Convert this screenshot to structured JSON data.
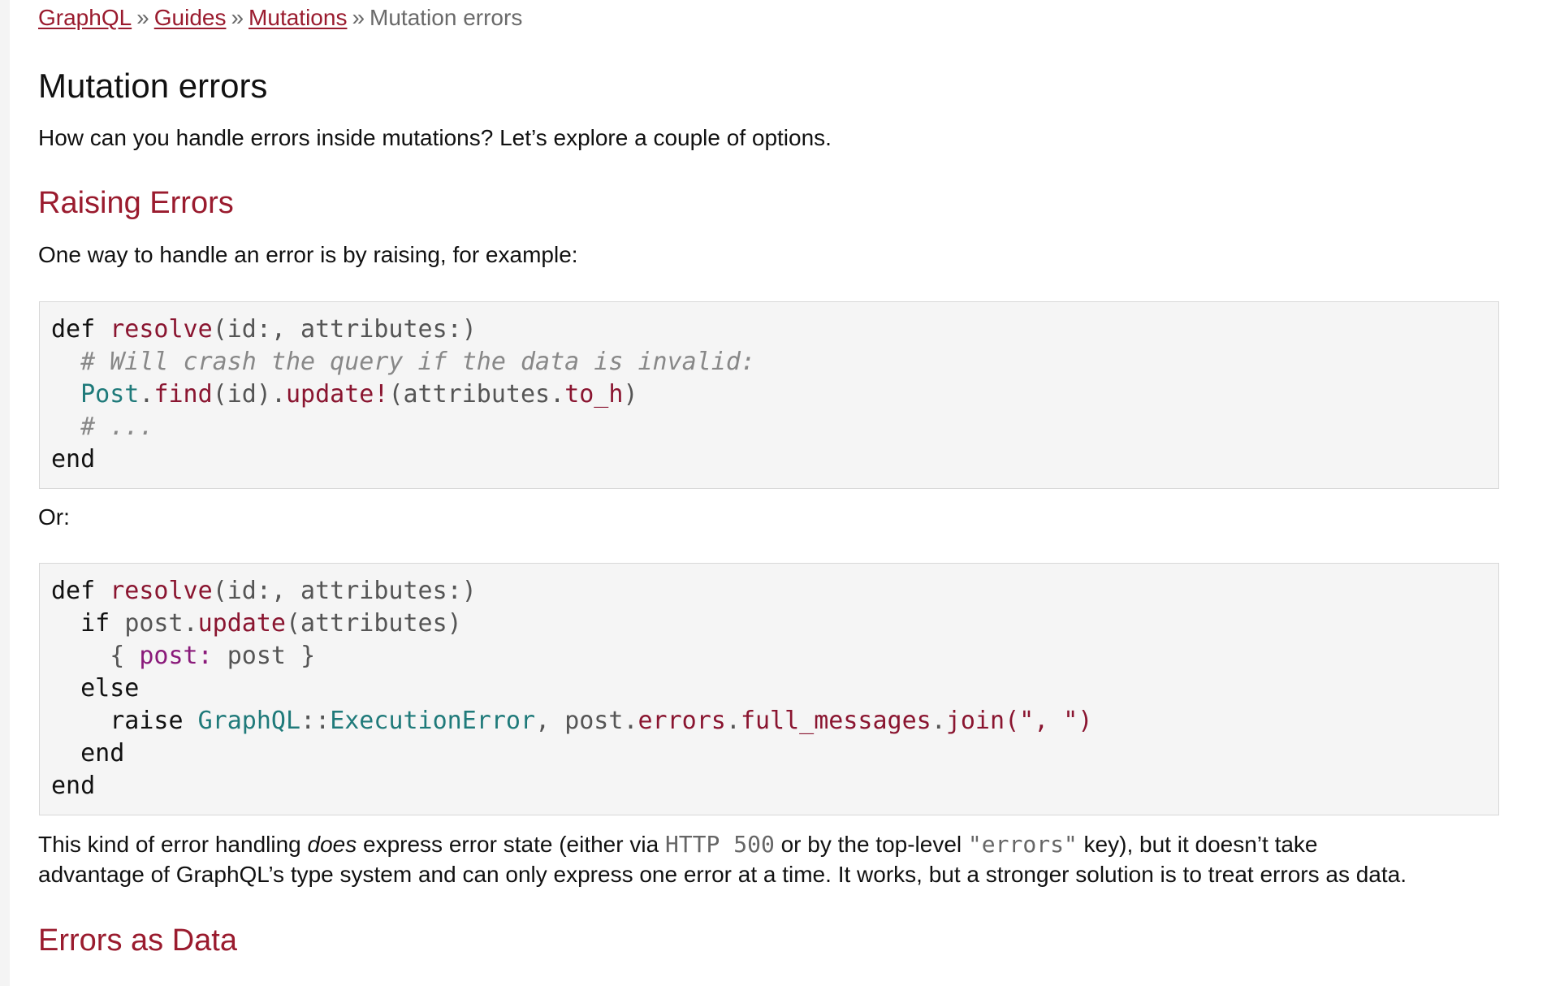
{
  "breadcrumb": {
    "items": [
      "GraphQL",
      "Guides",
      "Mutations"
    ],
    "separator": "»",
    "current": "Mutation errors"
  },
  "page": {
    "title": "Mutation errors",
    "intro": "How can you handle errors inside mutations? Let’s explore a couple of options."
  },
  "section1": {
    "heading": "Raising Errors",
    "text": "One way to handle an error is by raising, for example:",
    "or": "Or:"
  },
  "code1": {
    "def": "def",
    "resolve": "resolve",
    "args": "(id:, attributes:)",
    "comment1": "# Will crash the query if the data is invalid:",
    "post": "Post",
    "find": "find",
    "id_arg": "(id)",
    "update_bang": "update!",
    "attrs_open": "(attributes",
    "to_h": "to_h",
    "close": ")",
    "comment2": "# ...",
    "end": "end"
  },
  "code2": {
    "def": "def",
    "resolve": "resolve",
    "args": "(id:, attributes:)",
    "if": "if",
    "post_var": "post",
    "update": "update",
    "attrs": "(attributes)",
    "brace_open": "{",
    "post_key": "post:",
    "post_val": "post",
    "brace_close": "}",
    "else": "else",
    "raise": "raise",
    "graphql": "GraphQL",
    "colons": "::",
    "exec_error": "ExecutionError",
    "comma": ",",
    "errors": "errors",
    "full_messages": "full_messages",
    "join": "join",
    "join_args": "(\", \")",
    "end": "end"
  },
  "section1_after": {
    "p1_a": "This kind of error handling ",
    "p1_em": "does",
    "p1_b": " express error state (either via ",
    "p1_code1": "HTTP 500",
    "p1_c": " or by the top-level ",
    "p1_code2": "\"errors\"",
    "p1_d": " key), but it doesn’t take",
    "p2": "advantage of GraphQL’s type system and can only express one error at a time. It works, but a stronger solution is to treat errors as data."
  },
  "section2": {
    "heading": "Errors as Data"
  }
}
